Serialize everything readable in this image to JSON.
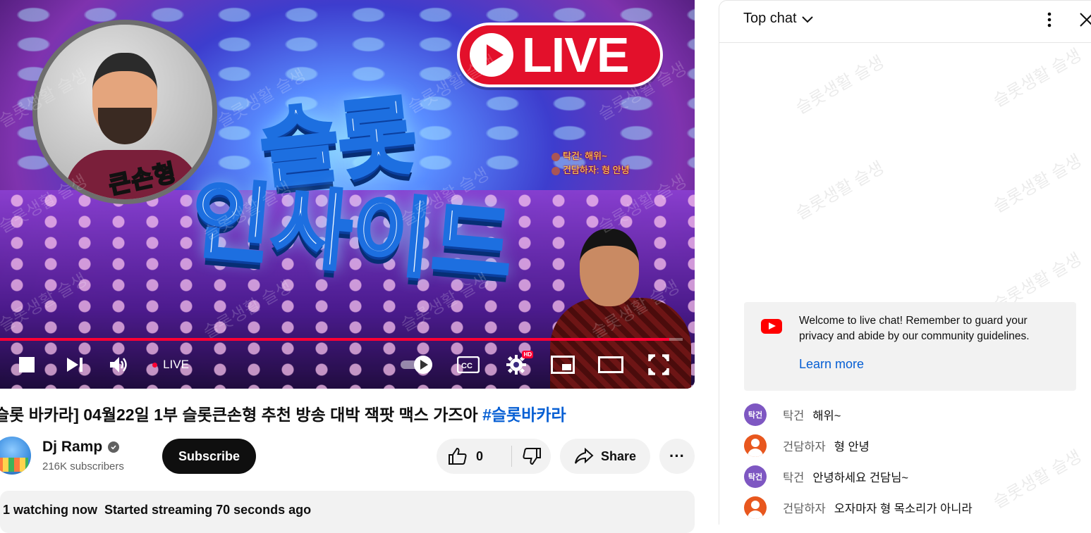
{
  "colors": {
    "accent_red": "#ff0033",
    "link_blue": "#065fd4",
    "live_pill": "#e3102b",
    "avatar_purple": "#7e57c2",
    "avatar_orange": "#e8571e"
  },
  "player": {
    "thumbnail": {
      "badge_name": "큰손형",
      "live_badge": "LIVE",
      "title_line1": "슬롯",
      "title_line2": "인사이드",
      "overlay_chat": [
        {
          "author": "탁건",
          "text": "해위~"
        },
        {
          "author": "건담하자",
          "text": "형 안녕"
        }
      ],
      "watermark": "슬롯생활 슬생"
    },
    "progress_fraction": 0.98,
    "live_label": "LIVE",
    "hd_badge": "HD",
    "icons": {
      "stop": "stop-icon",
      "next": "next-icon",
      "volume": "volume-icon",
      "autoplay": "autoplay-toggle-icon",
      "captions": "captions-icon",
      "settings": "gear-icon",
      "miniplayer": "miniplayer-icon",
      "theater": "theater-icon",
      "fullscreen": "fullscreen-icon"
    }
  },
  "video": {
    "title_main": "슬롯 바카라] 04월22일 1부 슬롯큰손형 추천 방송 대박 잭팟 맥스 가즈아 ",
    "title_hashtag": "#슬롯바카라",
    "channel_name": "Dj Ramp",
    "subscribers": "216K subscribers",
    "subscribe_label": "Subscribe",
    "like_count": "0",
    "share_label": "Share",
    "more_label": "···",
    "watching": "1 watching now",
    "started": "Started streaming 70 seconds ago"
  },
  "chat": {
    "mode_label": "Top chat",
    "welcome_text": "Welcome to live chat! Remember to guard your privacy and abide by our community guidelines.",
    "learn_more": "Learn more",
    "messages": [
      {
        "avatar_text": "탁건",
        "author": "탁건",
        "text": "해위~"
      },
      {
        "avatar_text": "",
        "author": "건담하자",
        "text": "형 안녕"
      },
      {
        "avatar_text": "탁건",
        "author": "탁건",
        "text": "안녕하세요 건담님~"
      },
      {
        "avatar_text": "",
        "author": "건담하자",
        "text": "오자마자 형 목소리가 아니라"
      }
    ]
  }
}
